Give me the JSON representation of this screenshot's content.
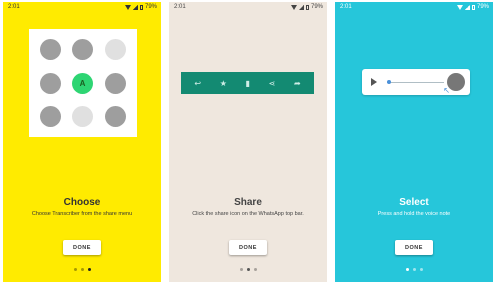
{
  "status": {
    "time": "2:01",
    "battery": "79%"
  },
  "screens": [
    {
      "title": "Choose",
      "subtitle": "Choose Transcriber from the share menu",
      "button": "DONE",
      "active_dot": 2,
      "bg": "#ffeb00",
      "center_icon_label": "A"
    },
    {
      "title": "Share",
      "subtitle": "Click the share icon on the WhatsApp top bar.",
      "button": "DONE",
      "active_dot": 1,
      "bg": "#efe7de",
      "toolbar_icons": [
        "reply-icon",
        "star-icon",
        "delete-icon",
        "share-icon",
        "forward-icon"
      ]
    },
    {
      "title": "Select",
      "subtitle": "Press and hold the voice note",
      "button": "DONE",
      "active_dot": 0,
      "bg": "#26c6da"
    }
  ]
}
